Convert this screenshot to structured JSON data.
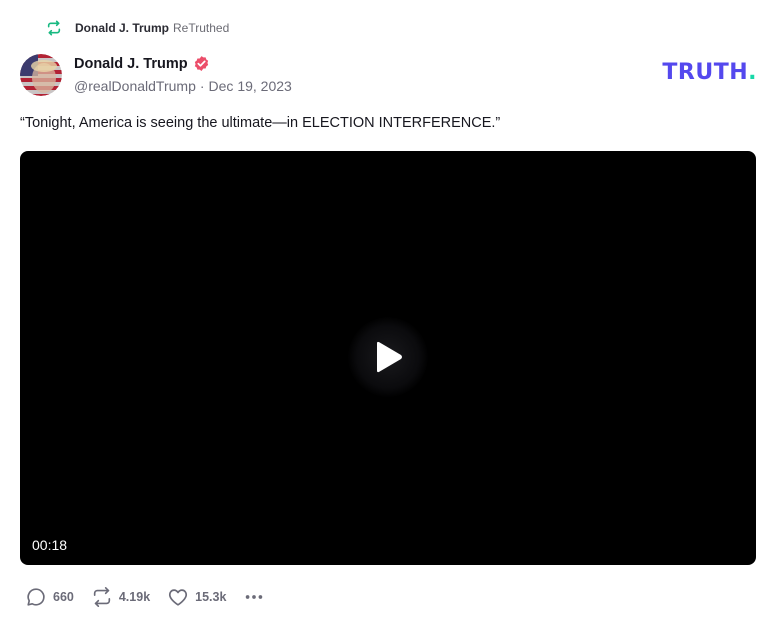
{
  "retruth": {
    "name": "Donald J. Trump",
    "suffix": "ReTruthed",
    "icon": "retruth-icon",
    "color": "#18b981"
  },
  "author": {
    "name": "Donald J. Trump",
    "handle": "@realDonaldTrump",
    "date": "Dec 19, 2023",
    "separator": "·",
    "verified_color": "#ec4e6a",
    "avatar": "avatar-icon"
  },
  "brand": {
    "text": "TRUTH",
    "dot": ".",
    "color": "#5448ee",
    "dot_color": "#17d8a8"
  },
  "post": {
    "text": "“Tonight, America is seeing the ultimate—in ELECTION INTERFERENCE.”"
  },
  "video": {
    "duration": "00:18",
    "play_icon": "play-icon"
  },
  "actions": {
    "replies": "660",
    "retruths": "4.19k",
    "likes": "15.3k",
    "more_icon": "more-icon"
  }
}
